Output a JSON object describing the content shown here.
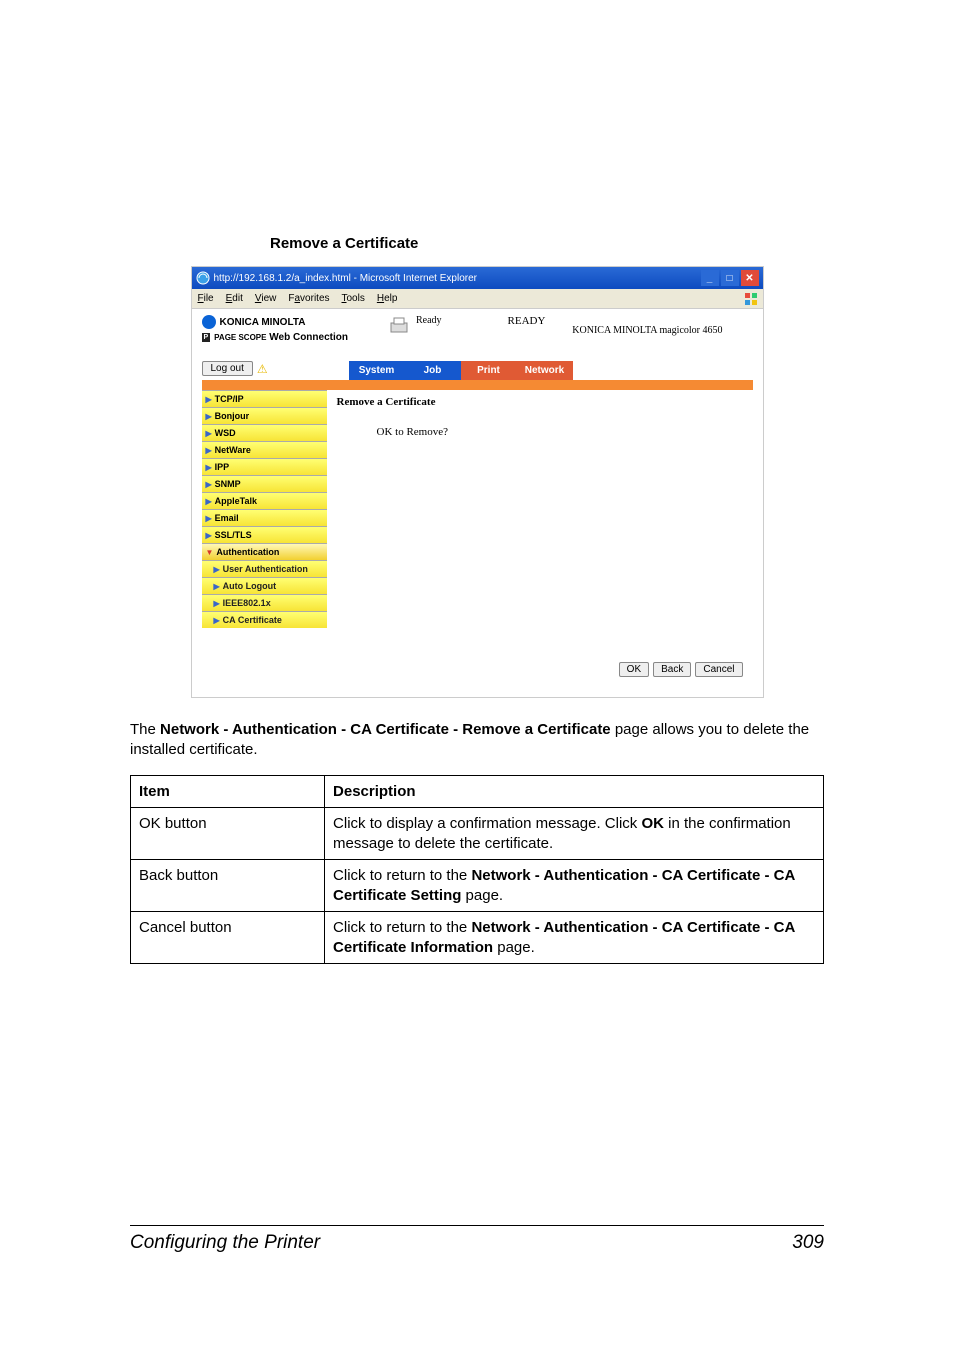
{
  "section_heading": "Remove a Certificate",
  "browser": {
    "title": "http://192.168.1.2/a_index.html - Microsoft Internet Explorer",
    "menu": {
      "file": "File",
      "edit": "Edit",
      "view": "View",
      "favorites": "Favorites",
      "tools": "Tools",
      "help": "Help"
    }
  },
  "header": {
    "brand": "KONICA MINOLTA",
    "page_scope": "PAGE SCOPE",
    "web_connection": "Web Connection",
    "ready_small": "Ready",
    "ready_big": "READY",
    "model": "KONICA MINOLTA magicolor 4650"
  },
  "logout_label": "Log out",
  "tabs": {
    "system": "System",
    "job": "Job",
    "print": "Print",
    "network": "Network"
  },
  "sidebar": [
    {
      "label": "TCP/IP"
    },
    {
      "label": "Bonjour"
    },
    {
      "label": "WSD"
    },
    {
      "label": "NetWare"
    },
    {
      "label": "IPP"
    },
    {
      "label": "SNMP"
    },
    {
      "label": "AppleTalk"
    },
    {
      "label": "Email"
    },
    {
      "label": "SSL/TLS"
    },
    {
      "label": "Authentication",
      "active": true
    },
    {
      "label": "User Authentication",
      "sub": true
    },
    {
      "label": "Auto Logout",
      "sub": true
    },
    {
      "label": "IEEE802.1x",
      "sub": true
    },
    {
      "label": "CA Certificate",
      "sub": true
    }
  ],
  "content": {
    "title": "Remove a Certificate",
    "msg": "OK to Remove?"
  },
  "buttons": {
    "ok": "OK",
    "back": "Back",
    "cancel": "Cancel"
  },
  "description_prefix": "The ",
  "description_bold": "Network - Authentication - CA Certificate - Remove a Certificate",
  "description_suffix": " page allows you to delete the installed certificate.",
  "table": {
    "head": {
      "item": "Item",
      "desc": "Description"
    },
    "rows": [
      {
        "item": "OK button",
        "desc_pre": "Click to display a confirmation message. Click ",
        "desc_b1": "OK",
        "desc_post": " in the confirmation message to delete the certificate."
      },
      {
        "item": "Back button",
        "desc_pre": "Click to return to the ",
        "desc_b1": "Network - Authentication - CA Certificate - CA Certificate Setting",
        "desc_post": " page."
      },
      {
        "item": "Cancel button",
        "desc_pre": "Click to return to the ",
        "desc_b1": "Network - Authentication - CA Certificate - CA Certificate Information",
        "desc_post": " page."
      }
    ]
  },
  "footer": {
    "title": "Configuring the Printer",
    "page": "309"
  }
}
